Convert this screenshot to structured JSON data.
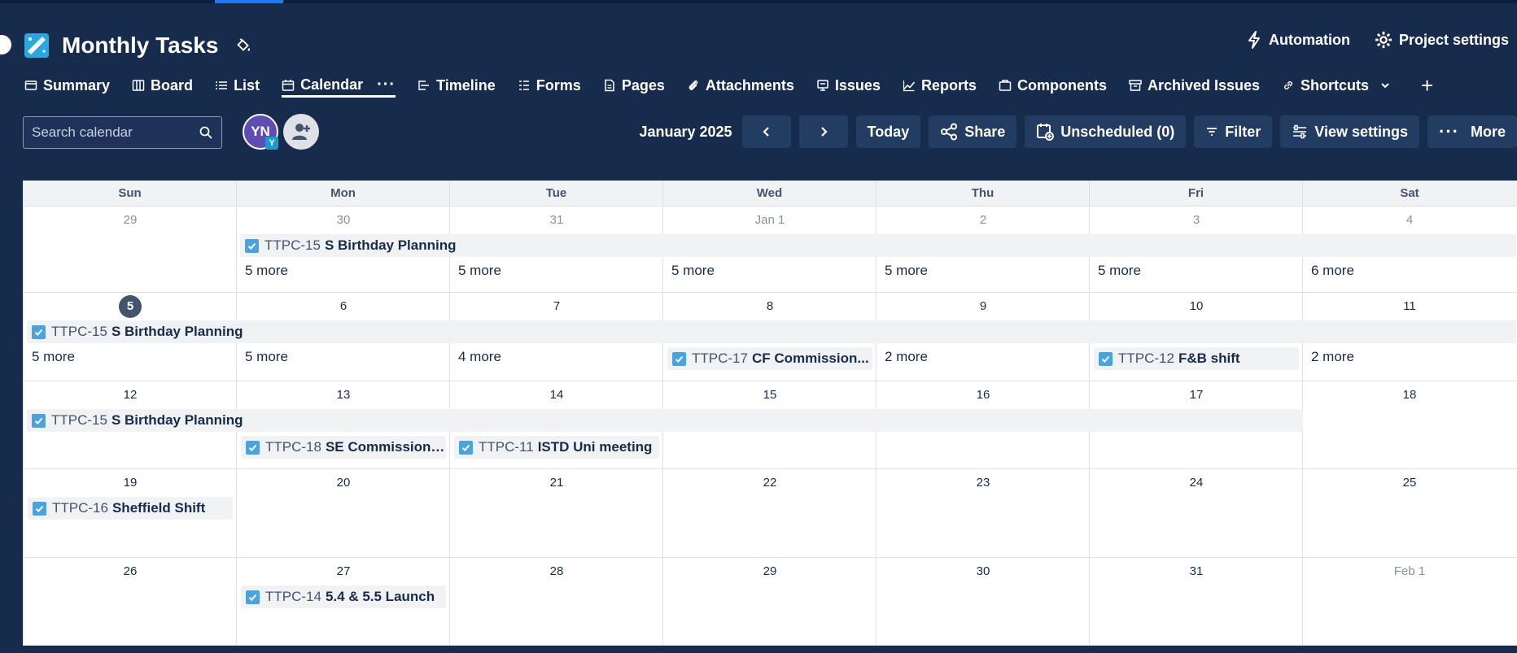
{
  "project": {
    "title": "Monthly Tasks"
  },
  "header": {
    "automation": "Automation",
    "project_settings": "Project settings"
  },
  "tabs": [
    {
      "label": "Summary",
      "icon": "summary-icon"
    },
    {
      "label": "Board",
      "icon": "board-icon"
    },
    {
      "label": "List",
      "icon": "list-icon"
    },
    {
      "label": "Calendar",
      "icon": "calendar-icon",
      "active": true
    },
    {
      "label": "Timeline",
      "icon": "timeline-icon"
    },
    {
      "label": "Forms",
      "icon": "forms-icon"
    },
    {
      "label": "Pages",
      "icon": "pages-icon"
    },
    {
      "label": "Attachments",
      "icon": "attachment-icon"
    },
    {
      "label": "Issues",
      "icon": "issues-icon"
    },
    {
      "label": "Reports",
      "icon": "reports-icon"
    },
    {
      "label": "Components",
      "icon": "components-icon"
    },
    {
      "label": "Archived Issues",
      "icon": "archive-icon"
    },
    {
      "label": "Shortcuts",
      "icon": "link-icon"
    }
  ],
  "toolbar": {
    "search_placeholder": "Search calendar",
    "avatar_initials": "YN",
    "avatar_badge": "Y",
    "month": "January 2025",
    "today": "Today",
    "share": "Share",
    "unscheduled": "Unscheduled (0)",
    "filter": "Filter",
    "view_settings": "View settings",
    "more": "More"
  },
  "calendar": {
    "weekdays": [
      "Sun",
      "Mon",
      "Tue",
      "Wed",
      "Thu",
      "Fri",
      "Sat"
    ],
    "weeks": [
      {
        "days": [
          {
            "label": "29",
            "muted": true
          },
          {
            "label": "30",
            "muted": true
          },
          {
            "label": "31",
            "muted": true
          },
          {
            "label": "Jan 1",
            "muted": true
          },
          {
            "label": "2",
            "muted": true
          },
          {
            "label": "3",
            "muted": true
          },
          {
            "label": "4",
            "muted": true
          }
        ],
        "events": [
          {
            "key": "TTPC-15",
            "title": "S Birthday Planning",
            "start": 1,
            "span": 6,
            "lane": 0
          }
        ],
        "more": [
          {
            "day": 1,
            "text": "5 more"
          },
          {
            "day": 2,
            "text": "5 more"
          },
          {
            "day": 3,
            "text": "5 more"
          },
          {
            "day": 4,
            "text": "5 more"
          },
          {
            "day": 5,
            "text": "5 more"
          },
          {
            "day": 6,
            "text": "6 more"
          }
        ]
      },
      {
        "days": [
          {
            "label": "5",
            "today": true
          },
          {
            "label": "6"
          },
          {
            "label": "7"
          },
          {
            "label": "8"
          },
          {
            "label": "9"
          },
          {
            "label": "10"
          },
          {
            "label": "11"
          }
        ],
        "events": [
          {
            "key": "TTPC-15",
            "title": "S Birthday Planning",
            "start": 0,
            "span": 7,
            "lane": 0
          },
          {
            "key": "TTPC-17",
            "title": "CF Commission...",
            "start": 3,
            "span": 1,
            "lane": 1
          },
          {
            "key": "TTPC-12",
            "title": "F&B shift",
            "start": 5,
            "span": 1,
            "lane": 1
          }
        ],
        "more": [
          {
            "day": 0,
            "text": "5 more"
          },
          {
            "day": 1,
            "text": "5 more"
          },
          {
            "day": 2,
            "text": "4 more"
          },
          {
            "day": 4,
            "text": "2 more"
          },
          {
            "day": 6,
            "text": "2 more"
          }
        ]
      },
      {
        "days": [
          {
            "label": "12"
          },
          {
            "label": "13"
          },
          {
            "label": "14"
          },
          {
            "label": "15"
          },
          {
            "label": "16"
          },
          {
            "label": "17"
          },
          {
            "label": "18"
          }
        ],
        "events": [
          {
            "key": "TTPC-15",
            "title": "S Birthday Planning",
            "start": 0,
            "span": 6,
            "lane": 0
          },
          {
            "key": "TTPC-18",
            "title": "SE Commission ...",
            "start": 1,
            "span": 1,
            "lane": 1
          },
          {
            "key": "TTPC-11",
            "title": "ISTD Uni meeting",
            "start": 2,
            "span": 1,
            "lane": 1
          }
        ],
        "more": []
      },
      {
        "days": [
          {
            "label": "19"
          },
          {
            "label": "20"
          },
          {
            "label": "21"
          },
          {
            "label": "22"
          },
          {
            "label": "23"
          },
          {
            "label": "24"
          },
          {
            "label": "25"
          }
        ],
        "events": [
          {
            "key": "TTPC-16",
            "title": "Sheffield Shift",
            "start": 0,
            "span": 1,
            "lane": 0
          }
        ],
        "more": []
      },
      {
        "days": [
          {
            "label": "26"
          },
          {
            "label": "27"
          },
          {
            "label": "28"
          },
          {
            "label": "29"
          },
          {
            "label": "30"
          },
          {
            "label": "31"
          },
          {
            "label": "Feb 1",
            "muted": true
          }
        ],
        "events": [
          {
            "key": "TTPC-14",
            "title": "5.4 & 5.5 Launch",
            "start": 1,
            "span": 1,
            "lane": 0
          }
        ],
        "more": []
      }
    ]
  },
  "colors": {
    "background": "#172b4d",
    "accent": "#1d7afc",
    "checkbox": "#4aa3df"
  }
}
